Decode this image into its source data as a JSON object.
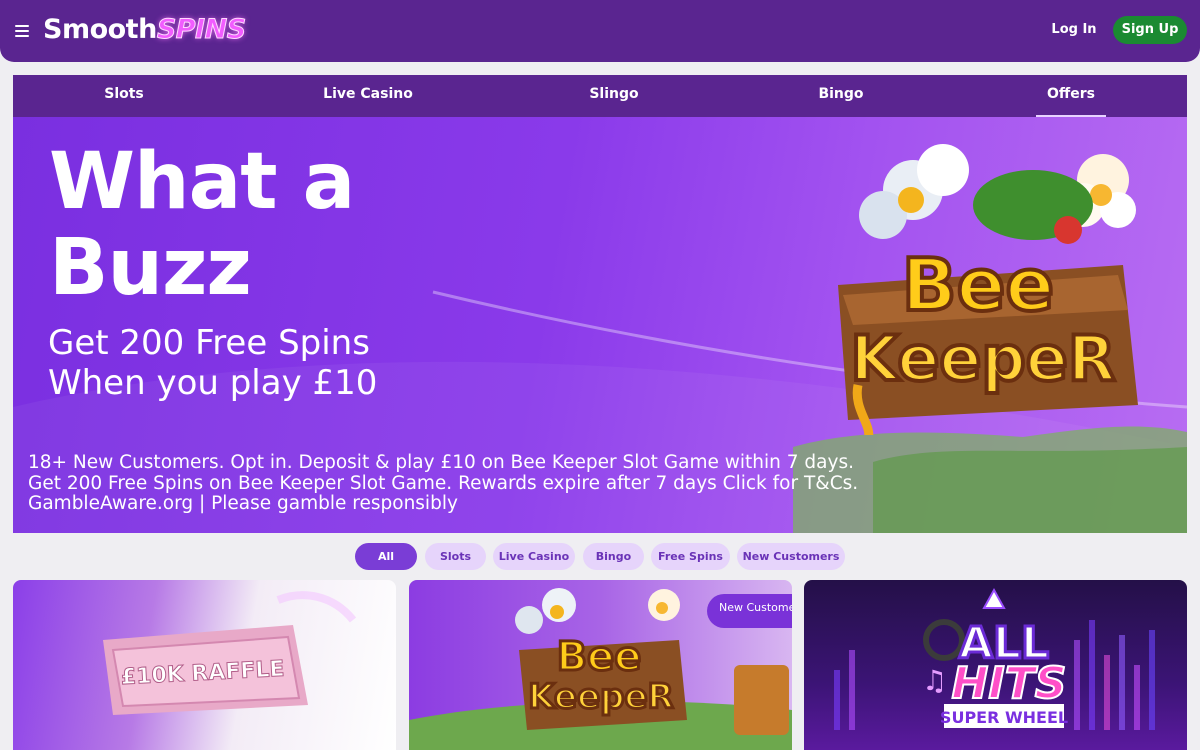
{
  "header": {
    "logo_main": "Smooth",
    "logo_accent": "SPINS",
    "login_label": "Log In",
    "signup_label": "Sign Up"
  },
  "nav": {
    "items": [
      {
        "label": "Slots"
      },
      {
        "label": "Live Casino"
      },
      {
        "label": "Slingo"
      },
      {
        "label": "Bingo"
      },
      {
        "label": "Offers",
        "active": true
      }
    ]
  },
  "hero": {
    "title_line1": "What a",
    "title_line2": "Buzz",
    "subtitle_line1": "Get 200 Free Spins",
    "subtitle_line2": "When you play £10",
    "terms_line1": "18+ New Customers. Opt in. Deposit & play £10 on Bee Keeper Slot Game within 7 days.",
    "terms_line2": "Get 200 Free Spins on Bee Keeper Slot Game. Rewards expire after 7 days Click for T&Cs.",
    "terms_line3": "GambleAware.org  | Please gamble responsibly",
    "game_logo_line1": "Bee",
    "game_logo_line2": "KeepeR"
  },
  "filters": {
    "items": [
      {
        "label": "All",
        "active": true
      },
      {
        "label": "Slots"
      },
      {
        "label": "Live Casino"
      },
      {
        "label": "Bingo"
      },
      {
        "label": "Free Spins"
      },
      {
        "label": "New Customers"
      }
    ]
  },
  "cards": [
    {
      "art_text": "£10K RAFFLE"
    },
    {
      "badge": "New Customers",
      "art_line1": "Bee",
      "art_line2": "KeepeR"
    },
    {
      "art_line1": "ALL",
      "art_line2": "HITS",
      "art_line3": "SUPER WHEEL"
    }
  ],
  "colors": {
    "header_bg": "#5a2590",
    "hero_bg": "#8a3aea",
    "signup_bg": "#1b8a32",
    "chip_bg": "#e6d4fb",
    "chip_active_bg": "#7a3dd6"
  }
}
